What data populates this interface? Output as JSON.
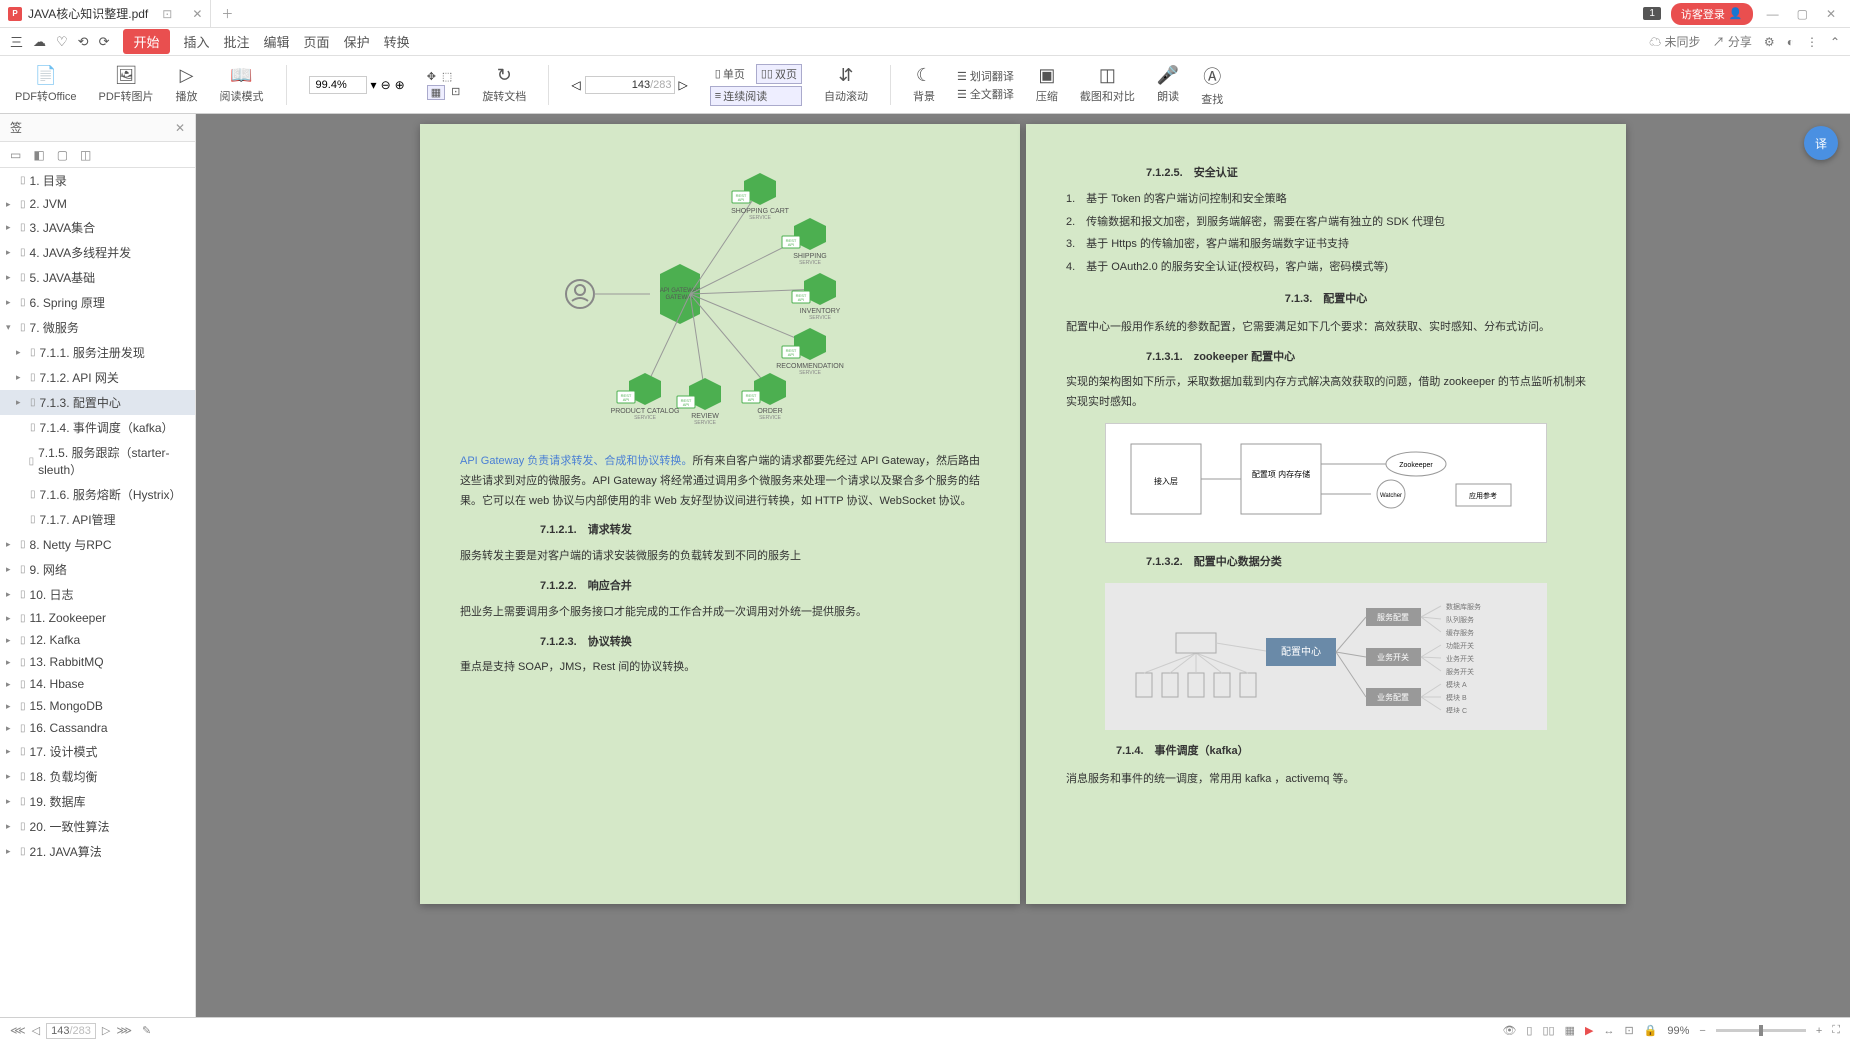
{
  "tab": {
    "title": "JAVA核心知识整理.pdf",
    "icon_letter": "P"
  },
  "titlebar": {
    "badge": "1",
    "guest_login": "访客登录"
  },
  "toolbar": {
    "menu": [
      "三",
      "☁",
      "♡",
      "⟲",
      "⟳"
    ],
    "active": "开始",
    "items": [
      "插入",
      "批注",
      "编辑",
      "页面",
      "保护",
      "转换"
    ],
    "right": {
      "unsync": "未同步",
      "share": "分享"
    }
  },
  "ribbon": {
    "pdf_to_office": "PDF转Office",
    "pdf_to_image": "PDF转图片",
    "play": "播放",
    "read_mode": "阅读模式",
    "zoom": "99.4%",
    "rotate": "旋转文档",
    "page_current": "143",
    "page_total": "/283",
    "single": "单页",
    "double": "双页",
    "continuous": "连续阅读",
    "auto_scroll": "自动滚动",
    "background": "背景",
    "word_translate": "划词翻译",
    "full_translate": "全文翻译",
    "compress": "压缩",
    "compare": "截图和对比",
    "read_aloud": "朗读",
    "find": "查找"
  },
  "panel": {
    "title": "签",
    "icons": [
      "▭",
      "◧",
      "▢",
      "◫"
    ]
  },
  "outline": [
    {
      "lvl": 1,
      "exp": "",
      "label": "1. 目录"
    },
    {
      "lvl": 1,
      "exp": "▸",
      "label": "2. JVM"
    },
    {
      "lvl": 1,
      "exp": "▸",
      "label": "3. JAVA集合"
    },
    {
      "lvl": 1,
      "exp": "▸",
      "label": "4. JAVA多线程并发"
    },
    {
      "lvl": 1,
      "exp": "▸",
      "label": "5. JAVA基础"
    },
    {
      "lvl": 1,
      "exp": "▸",
      "label": "6. Spring 原理"
    },
    {
      "lvl": 1,
      "exp": "▾",
      "label": "7. 微服务"
    },
    {
      "lvl": 2,
      "exp": "▸",
      "label": "7.1.1. 服务注册发现"
    },
    {
      "lvl": 2,
      "exp": "▸",
      "label": "7.1.2. API 网关"
    },
    {
      "lvl": 2,
      "exp": "▸",
      "label": "7.1.3. 配置中心",
      "active": true
    },
    {
      "lvl": 3,
      "exp": "",
      "label": "7.1.4. 事件调度（kafka）"
    },
    {
      "lvl": 3,
      "exp": "",
      "label": "7.1.5. 服务跟踪（starter-sleuth）"
    },
    {
      "lvl": 3,
      "exp": "",
      "label": "7.1.6. 服务熔断（Hystrix）"
    },
    {
      "lvl": 3,
      "exp": "",
      "label": "7.1.7. API管理"
    },
    {
      "lvl": 1,
      "exp": "▸",
      "label": "8. Netty 与RPC"
    },
    {
      "lvl": 1,
      "exp": "▸",
      "label": "9. 网络"
    },
    {
      "lvl": 1,
      "exp": "▸",
      "label": "10. 日志"
    },
    {
      "lvl": 1,
      "exp": "▸",
      "label": "11. Zookeeper"
    },
    {
      "lvl": 1,
      "exp": "▸",
      "label": "12. Kafka"
    },
    {
      "lvl": 1,
      "exp": "▸",
      "label": "13. RabbitMQ"
    },
    {
      "lvl": 1,
      "exp": "▸",
      "label": "14. Hbase"
    },
    {
      "lvl": 1,
      "exp": "▸",
      "label": "15. MongoDB"
    },
    {
      "lvl": 1,
      "exp": "▸",
      "label": "16. Cassandra"
    },
    {
      "lvl": 1,
      "exp": "▸",
      "label": "17. 设计模式"
    },
    {
      "lvl": 1,
      "exp": "▸",
      "label": "18. 负载均衡"
    },
    {
      "lvl": 1,
      "exp": "▸",
      "label": "19. 数据库"
    },
    {
      "lvl": 1,
      "exp": "▸",
      "label": "20. 一致性算法"
    },
    {
      "lvl": 1,
      "exp": "▸",
      "label": "21. JAVA算法"
    }
  ],
  "left_page": {
    "diagram_nodes": {
      "gateway": "API GATEWAY",
      "services": [
        "SHOPPING CART",
        "SHIPPING",
        "INVENTORY",
        "RECOMMENDATION",
        "ORDER",
        "REVIEW",
        "PRODUCT CATALOG"
      ],
      "badge": "REST API",
      "sub": "SERVICE"
    },
    "blue_lead": "API Gateway 负责请求转发、合成和协议转换。",
    "para1": "所有来自客户端的请求都要先经过 API Gateway，然后路由这些请求到对应的微服务。API Gateway 将经常通过调用多个微服务来处理一个请求以及聚合多个服务的结果。它可以在 web 协议与内部使用的非 Web 友好型协议间进行转换，如 HTTP 协议、WebSocket 协议。",
    "s1_num": "7.1.2.1.",
    "s1_title": "请求转发",
    "s1_body": "服务转发主要是对客户端的请求安装微服务的负载转发到不同的服务上",
    "s2_num": "7.1.2.2.",
    "s2_title": "响应合并",
    "s2_body": "把业务上需要调用多个服务接口才能完成的工作合并成一次调用对外统一提供服务。",
    "s3_num": "7.1.2.3.",
    "s3_title": "协议转换",
    "s3_body": "重点是支持 SOAP，JMS，Rest 间的协议转换。"
  },
  "right_page": {
    "s5_num": "7.1.2.5.",
    "s5_title": "安全认证",
    "list": [
      "1.　基于 Token 的客户端访问控制和安全策略",
      "2.　传输数据和报文加密，到服务端解密，需要在客户端有独立的 SDK 代理包",
      "3.　基于 Https 的传输加密，客户端和服务端数字证书支持",
      "4.　基于 OAuth2.0 的服务安全认证(授权码，客户端，密码模式等)"
    ],
    "s13_num": "7.1.3.",
    "s13_title": "配置中心",
    "s13_body": "配置中心一般用作系统的参数配置，它需要满足如下几个要求：高效获取、实时感知、分布式访问。",
    "s131_num": "7.1.3.1.",
    "s131_title": "zookeeper 配置中心",
    "s131_body": "实现的架构图如下所示，采取数据加载到内存方式解决高效获取的问题，借助 zookeeper 的节点监听机制来实现实时感知。",
    "diag2": {
      "boxes": [
        "接入层",
        "配置项 内存存储",
        "Zookeeper",
        "Watcher",
        "应用参考"
      ]
    },
    "s132_num": "7.1.3.2.",
    "s132_title": "配置中心数据分类",
    "diag3": {
      "center": "配置中心",
      "groups": [
        "服务配置",
        "业务开关",
        "业务配置"
      ],
      "items": [
        "数据库服务",
        "队列服务",
        "缓存服务",
        "功能开关",
        "业务开关",
        "服务开关",
        "模块 A",
        "模块 B",
        "模块 C"
      ]
    },
    "s14_num": "7.1.4.",
    "s14_title": "事件调度（kafka）",
    "s14_body": "消息服务和事件的统一调度，常用用 kafka ，activemq 等。"
  },
  "statusbar": {
    "page_current": "143",
    "page_total": "/283",
    "zoom": "99%"
  }
}
